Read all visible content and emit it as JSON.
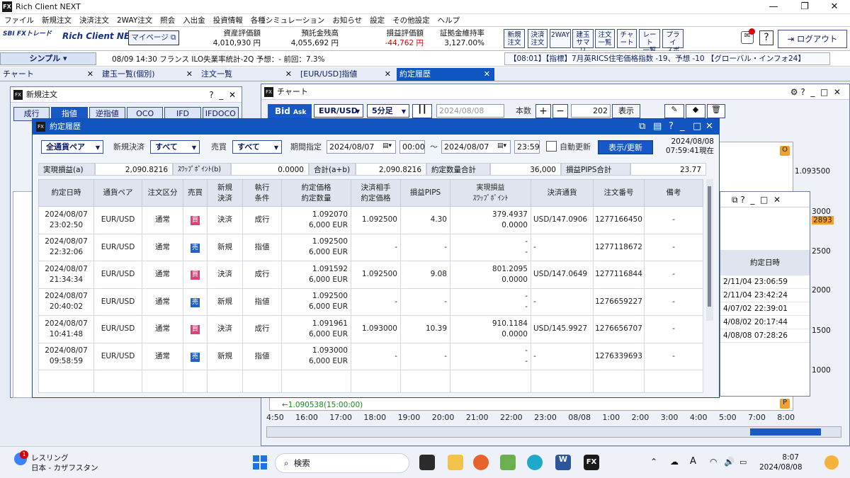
{
  "app": {
    "title": "Rich Client NEXT"
  },
  "menu": [
    "ファイル",
    "新規注文",
    "決済注文",
    "2WAY注文",
    "照会",
    "入出金",
    "投資情報",
    "各種シミュレーション",
    "お知らせ",
    "設定",
    "その他設定",
    "ヘルプ"
  ],
  "header": {
    "brand": "Rich Client NEXT",
    "mypage_label": "マイページ",
    "stats": [
      {
        "label": "資産評価額",
        "value": "4,010,930 円"
      },
      {
        "label": "預託金残高",
        "value": "4,055,692 円"
      },
      {
        "label": "損益評価額",
        "value": "-44,762 円"
      },
      {
        "label": "証拠金維持率",
        "value": "3,127.00%"
      }
    ],
    "quick_buttons": [
      "新規\n注文",
      "決済\n注文",
      "2WAY",
      "建玉\nサマリ",
      "注文\n一覧",
      "チャ\nート",
      "レート\n一覧",
      "プライ\nスボ"
    ],
    "logout_label": "ログアウト"
  },
  "ticker": {
    "mode": "シンプル",
    "headline": "08/09 14:30 フランス ILO失業率統計-2Q 予想：- 前回：7.3%",
    "news": "【08:01】【指標】7月英RICS住宅価格指数 -19、予想 -10 【グローバル・インフォ24】"
  },
  "tabs": [
    "チャート",
    "建玉一覧(個別)",
    "注文一覧",
    "[EUR/USD]指値",
    "約定履歴"
  ],
  "new_order": {
    "title": "新規注文",
    "order_types": [
      "成行",
      "指値",
      "逆指値",
      "OCO",
      "IFD",
      "IFDOCO"
    ]
  },
  "chart": {
    "title": "チャート",
    "bid_label": "Bid",
    "ask_label": "Ask",
    "pair": "EUR/USD",
    "timeframe": "5分足",
    "date": "2024/08/08",
    "count_label": "本数",
    "count": "202",
    "display_label": "表示",
    "price_label": "1.093500",
    "low_label": "←1.090538(15:00:00)",
    "time_ticks": [
      "4:50",
      "16:00",
      "17:00",
      "18:00",
      "19:00",
      "20:00",
      "21:00",
      "22:00",
      "23:00",
      "08/08",
      "1:00",
      "2:00",
      "3:00",
      "4:00",
      "5:00",
      "7:00",
      "8:00"
    ],
    "side_axis": [
      "3000",
      "2893",
      "2500",
      "2000",
      "1500",
      "1000"
    ]
  },
  "bg_list": {
    "header": "約定日時",
    "rows": [
      "2/11/04 23:06:59",
      "2/11/04 23:42:24",
      "4/07/02 22:39:01",
      "4/08/02 20:17:44",
      "4/08/08 07:28:26"
    ]
  },
  "history": {
    "title": "約定履歴",
    "filters": {
      "pair": "全通貨ペア",
      "new_close_label": "新規決済",
      "new_close": "すべて",
      "side_label": "売買",
      "side": "すべて",
      "period_label": "期間指定",
      "from_date": "2024/08/07",
      "from_time": "00:00",
      "tilde": "～",
      "to_date": "2024/08/07",
      "to_time": "23:59",
      "auto_update": "自動更新",
      "refresh": "表示/更新",
      "as_of_date": "2024/08/08",
      "as_of_time": "07:59:41現在"
    },
    "summary": {
      "realized_label": "実現損益(a)",
      "realized": "2,090.8216",
      "swap_label": "ｽﾜｯﾌﾟﾎﾟｲﾝﾄ(b)",
      "swap": "0.0000",
      "total_label": "合計(a+b)",
      "total": "2,090.8216",
      "qty_label": "約定数量合計",
      "qty": "36,000",
      "pips_label": "損益PIPS合計",
      "pips": "23.77"
    },
    "columns": {
      "datetime": "約定日時",
      "pair": "通貨ペア",
      "kind": "注文区分",
      "side": "売買",
      "new_close": "新規\n決済",
      "cond": "執行\n条件",
      "price": "約定価格\n約定数量",
      "counter": "決済相手\n約定価格",
      "pips": "損益PIPS",
      "pnl": "実現損益\nｽﾜｯﾌﾟﾎﾟｲﾝﾄ",
      "ccy": "決済通貨",
      "order_no": "注文番号",
      "note": "備考"
    },
    "rows": [
      {
        "date": "2024/08/07",
        "time": "23:02:50",
        "pair": "EUR/USD",
        "kind": "通常",
        "side": "買",
        "new_close": "決済",
        "cond": "成行",
        "price": "1.092070",
        "qty": "6,000 EUR",
        "counter": "1.092500",
        "pips": "4.30",
        "pnl": "379.4937",
        "swap": "0.0000",
        "ccy": "USD/147.0906",
        "order_no": "1277166450",
        "note": "-"
      },
      {
        "date": "2024/08/07",
        "time": "22:32:06",
        "pair": "EUR/USD",
        "kind": "通常",
        "side": "売",
        "new_close": "新規",
        "cond": "指値",
        "price": "1.092500",
        "qty": "6,000 EUR",
        "counter": "-",
        "pips": "-",
        "pnl": "-",
        "swap": "-",
        "ccy": "-",
        "order_no": "1277118672",
        "note": "-"
      },
      {
        "date": "2024/08/07",
        "time": "21:34:34",
        "pair": "EUR/USD",
        "kind": "通常",
        "side": "買",
        "new_close": "決済",
        "cond": "成行",
        "price": "1.091592",
        "qty": "6,000 EUR",
        "counter": "1.092500",
        "pips": "9.08",
        "pnl": "801.2095",
        "swap": "0.0000",
        "ccy": "USD/147.0649",
        "order_no": "1277116844",
        "note": "-"
      },
      {
        "date": "2024/08/07",
        "time": "20:40:02",
        "pair": "EUR/USD",
        "kind": "通常",
        "side": "売",
        "new_close": "新規",
        "cond": "指値",
        "price": "1.092500",
        "qty": "6,000 EUR",
        "counter": "-",
        "pips": "-",
        "pnl": "-",
        "swap": "-",
        "ccy": "-",
        "order_no": "1276659227",
        "note": "-"
      },
      {
        "date": "2024/08/07",
        "time": "10:41:48",
        "pair": "EUR/USD",
        "kind": "通常",
        "side": "買",
        "new_close": "決済",
        "cond": "成行",
        "price": "1.091961",
        "qty": "6,000 EUR",
        "counter": "1.093000",
        "pips": "10.39",
        "pnl": "910.1184",
        "swap": "0.0000",
        "ccy": "USD/145.9927",
        "order_no": "1276656707",
        "note": "-"
      },
      {
        "date": "2024/08/07",
        "time": "09:58:59",
        "pair": "EUR/USD",
        "kind": "通常",
        "side": "売",
        "new_close": "新規",
        "cond": "指値",
        "price": "1.093000",
        "qty": "6,000 EUR",
        "counter": "-",
        "pips": "-",
        "pnl": "-",
        "swap": "-",
        "ccy": "-",
        "order_no": "1276339693",
        "note": "-"
      }
    ]
  },
  "taskbar": {
    "weather_title": "レスリング",
    "weather_sub": "日本 - カザフスタン",
    "search": "検索",
    "time": "8:07",
    "date": "2024/08/08",
    "badge": "1",
    "ime": "A"
  },
  "colors": {
    "accent": "#1254c0",
    "loss": "#dd0000",
    "buy": "#d6447a",
    "sell": "#2160c8"
  }
}
